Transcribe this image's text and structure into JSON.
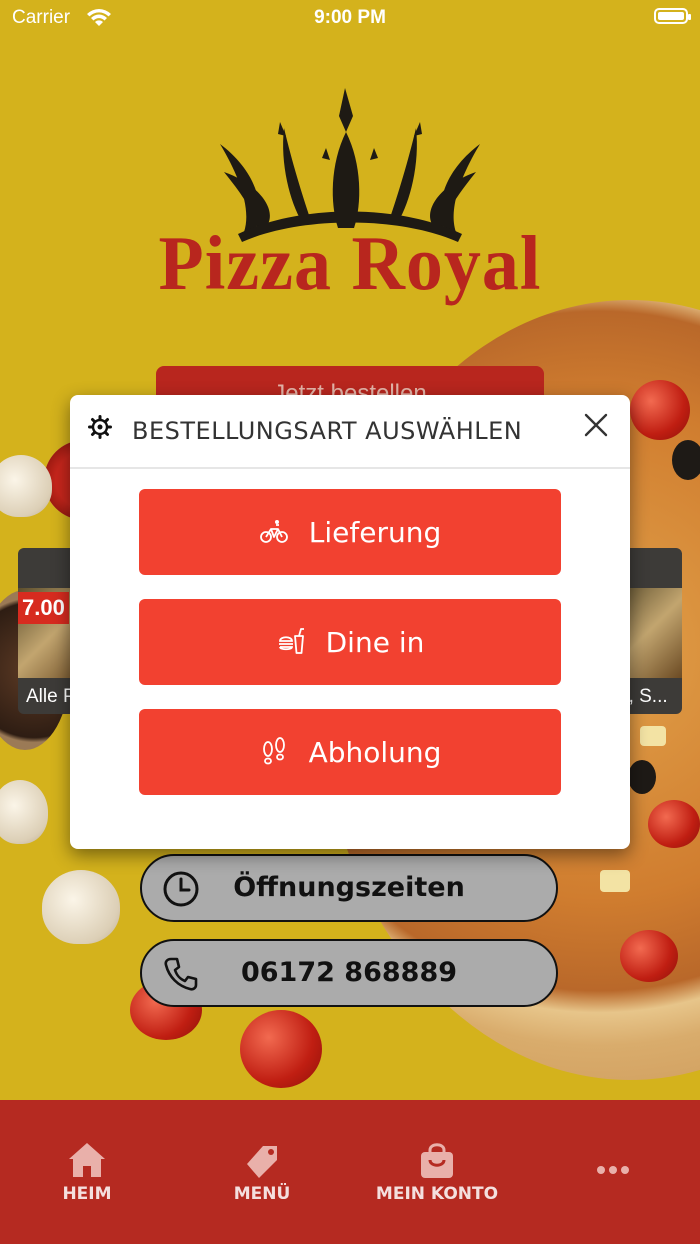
{
  "status_bar": {
    "carrier": "Carrier",
    "time": "9:00 PM"
  },
  "brand": {
    "name": "Pizza Royal",
    "color": "#b8261e"
  },
  "hero": {
    "order_button_label": "Jetzt bestellen"
  },
  "cards": [
    {
      "price": "7.00",
      "caption": "Alle Pi"
    },
    {
      "caption": "n, S..."
    }
  ],
  "info": {
    "hours_label": "Öffnungszeiten",
    "phone_label": "06172 868889"
  },
  "modal": {
    "title": "BESTELLUNGSART AUSWÄHLEN",
    "options": [
      {
        "label": "Lieferung",
        "icon": "bicycle-icon"
      },
      {
        "label": "Dine in",
        "icon": "burger-drink-icon"
      },
      {
        "label": "Abholung",
        "icon": "footsteps-icon"
      }
    ],
    "accent": "#f24130"
  },
  "tabbar": {
    "background": "#b52a21",
    "items": [
      {
        "label": "HEIM",
        "icon": "home-icon"
      },
      {
        "label": "MENÜ",
        "icon": "tag-icon"
      },
      {
        "label": "MEIN KONTO",
        "icon": "shopping-bag-icon"
      },
      {
        "label": "",
        "icon": "more-icon"
      }
    ]
  }
}
